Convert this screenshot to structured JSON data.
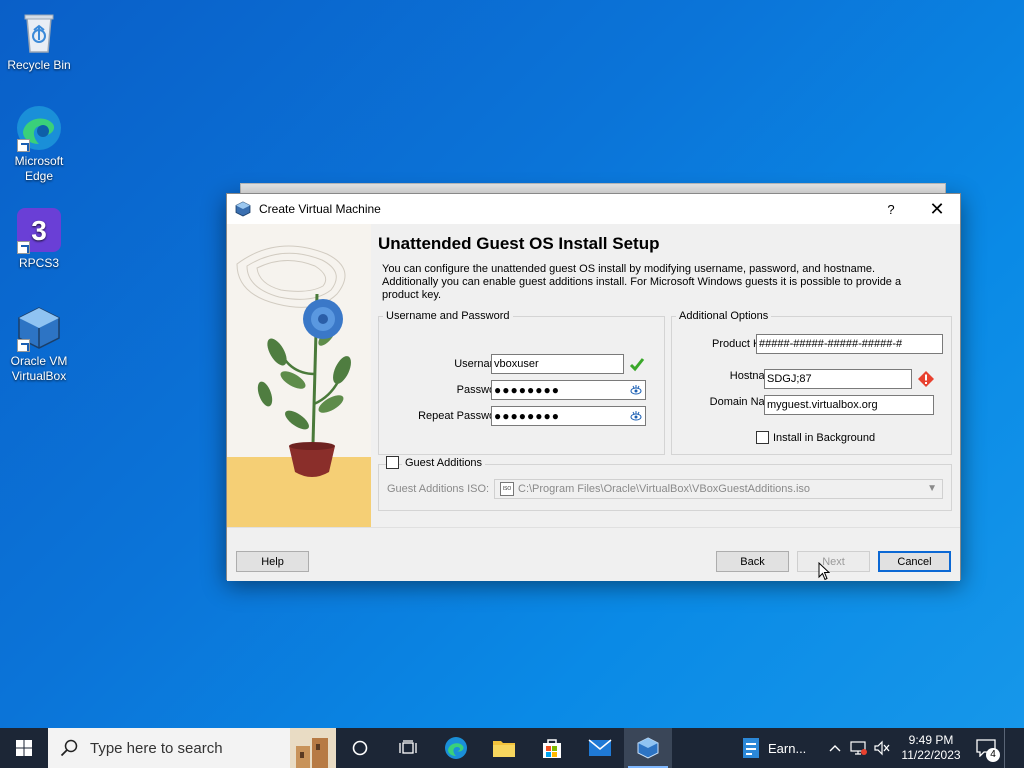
{
  "desktop": {
    "icons": [
      {
        "label": "Recycle Bin"
      },
      {
        "label": "Microsoft Edge"
      },
      {
        "label": "RPCS3"
      },
      {
        "label": "Oracle VM VirtualBox"
      }
    ]
  },
  "dialog": {
    "window_title": "Create Virtual Machine",
    "help_glyph": "?",
    "close_glyph": "✕",
    "heading": "Unattended Guest OS Install Setup",
    "description": "You can configure the unattended guest OS install by modifying username, password, and hostname. Additionally you can enable guest additions install. For Microsoft Windows guests it is possible to provide a product key.",
    "user_group": {
      "title": "Username and Password",
      "username_label": "Username:",
      "username_value": "vboxuser",
      "password_label": "Password:",
      "password_value": "●●●●●●●●",
      "repeat_label": "Repeat Password:",
      "repeat_value": "●●●●●●●●"
    },
    "options_group": {
      "title": "Additional Options",
      "product_key_label": "Product Key:",
      "product_key_value": "#####-#####-#####-#####-#",
      "hostname_label": "Hostname:",
      "hostname_value": "SDGJ;87",
      "domain_label": "Domain Name:",
      "domain_value": "myguest.virtualbox.org",
      "install_bg_label": "Install in Background"
    },
    "guest_additions": {
      "label": "Guest Additions",
      "iso_label": "Guest Additions ISO:",
      "iso_value": "C:\\Program Files\\Oracle\\VirtualBox\\VBoxGuestAdditions.iso",
      "iso_icon_text": "ISO"
    },
    "buttons": {
      "help": "Help",
      "back": "Back",
      "next": "Next",
      "cancel": "Cancel"
    }
  },
  "taskbar": {
    "search_placeholder": "Type here to search",
    "app_label": "Earn...",
    "time": "9:49 PM",
    "date": "11/22/2023",
    "notification_count": "4"
  },
  "colors": {
    "accent": "#0b68d4",
    "valid": "#3aa82a",
    "error": "#e8412f",
    "taskbar": "#1c2636"
  }
}
